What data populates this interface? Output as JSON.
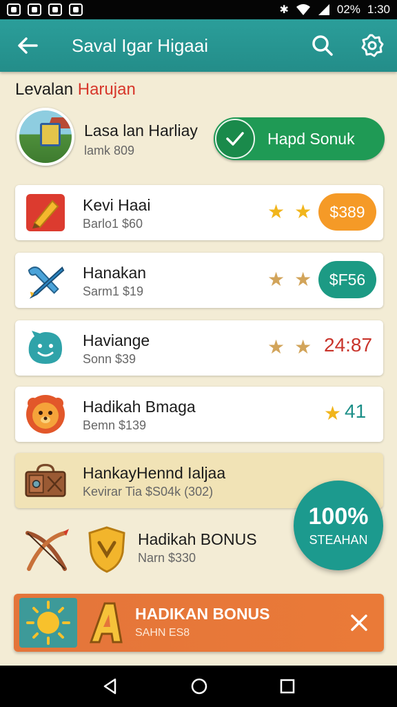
{
  "status_bar": {
    "battery": "02%",
    "time": "1:30"
  },
  "app_bar": {
    "title": "Saval Igar Higaai"
  },
  "section": {
    "title_part1": "Levalan ",
    "title_part2": "Harujan"
  },
  "profile": {
    "name": "Lasa lan Harliay",
    "subtitle": "lamk 809",
    "bonus_button": "Hapd Sonuk"
  },
  "list": [
    {
      "name": "Kevi Haai",
      "sub": "Barlo1 $60",
      "stars": 2,
      "value": "$389",
      "value_style": "orange-pill"
    },
    {
      "name": "Hanakan",
      "sub": "Sarm1 $19",
      "stars": 2,
      "value": "$F56",
      "value_style": "teal-pill"
    },
    {
      "name": "Haviange",
      "sub": "Sonn $39",
      "stars": 2,
      "value": "24:87",
      "value_style": "red-text"
    },
    {
      "name": "Hadikah Bmaga",
      "sub": "Bemn $139",
      "stars": 1,
      "value": "41",
      "value_style": "teal-text"
    },
    {
      "name": "HankayHennd Ialjaa",
      "sub": "Kevirar Tia $S04k (302)",
      "highlighted": true
    }
  ],
  "bonus_item": {
    "name": "Hadikah BONUS",
    "sub": "Narn $330"
  },
  "fab": {
    "line1": "100%",
    "line2": "STEAHAN"
  },
  "banner": {
    "title": "HADIKAN BONUS",
    "sub": "SAHN ES8"
  },
  "colors": {
    "teal": "#2b9e9a",
    "green": "#1f9a55",
    "orange": "#f59a27",
    "red_accent": "#d7362a",
    "banner": "#e4753a"
  }
}
